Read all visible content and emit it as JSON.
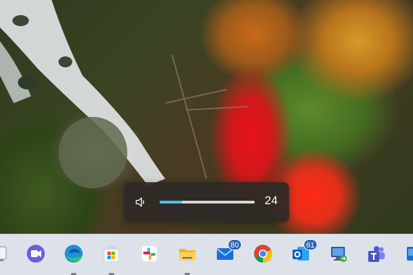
{
  "volume_flyout": {
    "icon": "speaker-icon",
    "level_percent": 24,
    "value_label": "24",
    "accent_color": "#4cc2ff"
  },
  "taskbar": {
    "icons": [
      {
        "name": "partial-app-icon"
      },
      {
        "name": "teams-chat-icon"
      },
      {
        "name": "edge-icon",
        "running": true
      },
      {
        "name": "microsoft-store-icon",
        "running": true
      },
      {
        "name": "slack-icon"
      },
      {
        "name": "file-explorer-icon",
        "running": true
      },
      {
        "name": "mail-icon",
        "badge": "80"
      },
      {
        "name": "chrome-icon"
      },
      {
        "name": "outlook-icon",
        "badge": "61"
      },
      {
        "name": "remote-desktop-icon"
      },
      {
        "name": "teams-icon"
      },
      {
        "name": "partial-app-icon-right"
      }
    ]
  }
}
